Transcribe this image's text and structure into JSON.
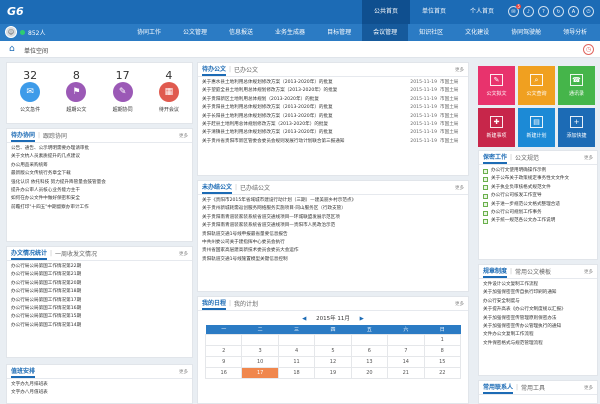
{
  "brand": {
    "logo": "G6"
  },
  "top_tabs": [
    {
      "label": "公共首页",
      "active": true
    },
    {
      "label": "单位首页",
      "active": false
    },
    {
      "label": "个人首页",
      "active": false
    }
  ],
  "top_icons": [
    {
      "name": "message-icon",
      "glyph": "✉",
      "badge": "5"
    },
    {
      "name": "bell-icon",
      "glyph": "♪",
      "badge": ""
    },
    {
      "name": "help-icon",
      "glyph": "?",
      "badge": ""
    },
    {
      "name": "refresh-icon",
      "glyph": "↻",
      "badge": ""
    },
    {
      "name": "font-size-icon",
      "glyph": "A",
      "badge": ""
    },
    {
      "name": "power-icon",
      "glyph": "⏻",
      "badge": ""
    }
  ],
  "user": {
    "count_label": "852人"
  },
  "nav": [
    {
      "label": "协同工作",
      "active": false
    },
    {
      "label": "公文管理",
      "active": false
    },
    {
      "label": "信息报送",
      "active": false
    },
    {
      "label": "业务生成器",
      "active": false
    },
    {
      "label": "目标管理",
      "active": false
    },
    {
      "label": "会议管理",
      "active": true
    },
    {
      "label": "知识社区",
      "active": false
    },
    {
      "label": "文化建设",
      "active": false
    },
    {
      "label": "协同驾驶舱",
      "active": false
    },
    {
      "label": "领导分析",
      "active": false
    }
  ],
  "breadcrumb": {
    "title": "单位空间"
  },
  "stats": [
    {
      "num": "32",
      "label": "公文急件",
      "color": "#3d9be9",
      "glyph": "✉"
    },
    {
      "num": "8",
      "label": "超期公文",
      "color": "#9b59b6",
      "glyph": "⚑"
    },
    {
      "num": "17",
      "label": "超期协同",
      "color": "#9b59b6",
      "glyph": "✎"
    },
    {
      "num": "4",
      "label": "待开会议",
      "color": "#e05a4f",
      "glyph": "▦"
    }
  ],
  "panel_collab": {
    "tab1": "待办协同",
    "tab2": "跟踪协同",
    "more": "更多",
    "items": [
      "公告、通告、公示明明需要办理请审批",
      "关于文杭人员素质提升的几点建议",
      "办公用品采购统筹",
      "最新版公文传统行务章全下载",
      "强化认识 依托科技 努力提升降管量会鼓管量会",
      "提升办公审人员核心业务能力主干",
      "如何在办公文件中做好保密和安全",
      "前瞻打印\"十四五\"中期督察办审计工作"
    ]
  },
  "panel_office": {
    "tab1": "办文情况统计",
    "tab2": "一周收发文情况",
    "more": "更多",
    "items": [
      "办公行局公局第国工作情况第22期",
      "办公行局公局第国工作情况第21期",
      "办公行局公局第国工作情况第20期",
      "办公行局公局第国工作情况第18期",
      "办公行局公局第国工作情况第17期",
      "办公行局公局第国工作情况第16期",
      "办公行局公局第国工作情况第15期",
      "办公行局公局第国工作情况第14期"
    ]
  },
  "panel_duty": {
    "tab1": "值班安排",
    "more": "更多",
    "items": [
      "文字办九月排班表",
      "文字办八月值班表"
    ]
  },
  "panel_docs": {
    "tab1": "待办公文",
    "tab2": "已办公文",
    "more": "更多",
    "rows": [
      {
        "title": "关于惠水县土地利用总体规划修改方案（2013-2020年）的批复",
        "date": "2015-11-19",
        "dept": "市国土局"
      },
      {
        "title": "关于望庭全县土地利用总体规划修改方案（2013-2020年）的批复",
        "date": "2015-11-19",
        "dept": "市国土局"
      },
      {
        "title": "关于贵阳新区土地利用总体规划（2013-2020年）的批复",
        "date": "2015-11-19",
        "dept": "市国土局"
      },
      {
        "title": "关于贵阳县土地利用总体规划修改方案（2013-2020年）的批复",
        "date": "2015-11-19",
        "dept": "市国土局"
      },
      {
        "title": "关于长阳县土地利用总体规划修改方案（2013-2020年）的批复",
        "date": "2015-11-19",
        "dept": "市国土局"
      },
      {
        "title": "关于赶县土地利用总体规划修改方案（2013-2020年）的批复",
        "date": "2015-11-19",
        "dept": "市国土局"
      },
      {
        "title": "关于清镇县土地利用总体规划修改方案（2013-2020年）的批复",
        "date": "2015-11-19",
        "dept": "市国土局"
      },
      {
        "title": "关于贵州省贵阳市新区管委会委员会规则发展行动计划联合第三报通知",
        "date": "2015-11-19",
        "dept": "市国土局"
      }
    ]
  },
  "panel_mail": {
    "tab1": "未办结公文",
    "tab2": "已办结公文",
    "more": "更多",
    "items": [
      "关于《贵阳市2015年省域城市建设行动计划（三期）—建美丽乡村示范点》",
      "关于贵州新城耗需返创服务网络服务实施项目·同山服务区（行政支管）",
      "关于贵阳南青道装家装系统省道交通线项目—环城联盟发展示范区项",
      "关于贵阳南青道装家装系统省道交通线项目—贵阳市人民政治示范",
      "贵阳轨道交通1号线申报最省量要信息报告",
      "中共州委公司关于建指挥中心委员会执行",
      "贵州省国家高层建高新技术委员会委员大会运作",
      "贵阳轨道交通1号线施置模型关键信息控制"
    ]
  },
  "panel_calendar": {
    "tab1": "我的日程",
    "tab2": "我的计划",
    "more": "更多",
    "month_label": "2015年 11月",
    "weekdays": [
      "一",
      "二",
      "三",
      "四",
      "五",
      "六",
      "日"
    ],
    "rows": [
      [
        "",
        "",
        "",
        "",
        "",
        "",
        "1"
      ],
      [
        "2",
        "3",
        "4",
        "5",
        "6",
        "7",
        "8"
      ],
      [
        "9",
        "10",
        "11",
        "12",
        "13",
        "14",
        "15"
      ],
      [
        "16",
        "17",
        "18",
        "19",
        "20",
        "21",
        "22"
      ]
    ],
    "today": "17"
  },
  "tiles": [
    {
      "label": "公文拟文",
      "color": "#e8336d",
      "glyph": "✎"
    },
    {
      "label": "公文查询",
      "color": "#f0a020",
      "glyph": "⌕"
    },
    {
      "label": "通讯录",
      "color": "#45b54a",
      "glyph": "☎"
    },
    {
      "label": "新建事项",
      "color": "#c7264a",
      "glyph": "✚"
    },
    {
      "label": "新建计划",
      "color": "#1c8ad6",
      "glyph": "▤"
    },
    {
      "label": "添加快捷",
      "color": "#1c6bb5",
      "glyph": "+"
    }
  ],
  "panel_confidential": {
    "tab1": "保密工作",
    "tab2": "公文规范",
    "more": "更多",
    "items": [
      "办公行文使用明确操作示例",
      "关于公布关于政策规定事务性文文件文",
      "关于执业负审核格式规范文件",
      "办公行公司核发工作宣导",
      "关于进一步规范公文格式整理合适",
      "办公行公司规划工作事务",
      "关于统一规范各公文办工作说明"
    ]
  },
  "panel_rules": {
    "tab1": "规章制度",
    "tab2": "常用公文模板",
    "more": "更多",
    "items": [
      "文件设计公文复制工作流程",
      "关于加强保密宣传自执行印刷的通知",
      "办公行安全制度与",
      "关于提升高表《办公行文制度规以汇报》",
      "关于加强保密宣传管理原则保密办法",
      "关于加强保密宣传办公管理执行的通知",
      "文件办公文复制工作流程",
      "文件保密格式与规范管理流程"
    ]
  },
  "panel_contacts": {
    "tab1": "常用联系人",
    "tab2": "常用工具",
    "more": "更多"
  }
}
